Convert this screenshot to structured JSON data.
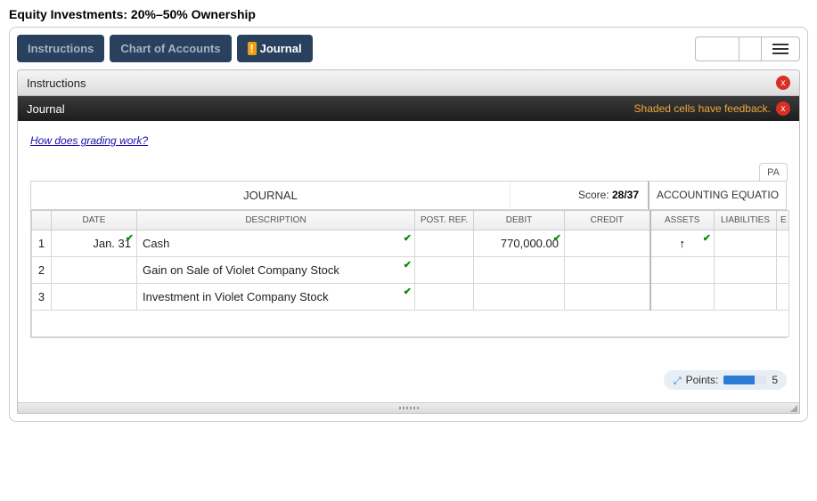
{
  "title": "Equity Investments: 20%–50% Ownership",
  "tabs": {
    "instructions": "Instructions",
    "chart_of_accounts": "Chart of Accounts",
    "journal": "Journal",
    "bang": "!"
  },
  "instructions_header": "Instructions",
  "journal_header": "Journal",
  "feedback_note": "Shaded cells have feedback.",
  "grading_link": "How does grading work?",
  "pa_tab": "PA",
  "journal_title": "JOURNAL",
  "score_label": "Score:",
  "score_value": "28/37",
  "acct_eq_label": "ACCOUNTING EQUATIO",
  "columns": {
    "date": "DATE",
    "description": "DESCRIPTION",
    "post_ref": "POST. REF.",
    "debit": "DEBIT",
    "credit": "CREDIT",
    "assets": "ASSETS",
    "liabilities": "LIABILITIES",
    "eq": "E"
  },
  "rows": [
    {
      "n": "1",
      "date": "Jan. 31",
      "description": "Cash",
      "post_ref": "",
      "debit": "770,000.00",
      "credit": "",
      "assets": "↑",
      "liabilities": "",
      "date_check": true,
      "desc_check": true,
      "debit_check": true,
      "assets_check": true
    },
    {
      "n": "2",
      "date": "",
      "description": "Gain on Sale of Violet Company Stock",
      "post_ref": "",
      "debit": "",
      "credit": "",
      "assets": "",
      "liabilities": "",
      "desc_check": true
    },
    {
      "n": "3",
      "date": "",
      "description": "Investment in Violet Company Stock",
      "post_ref": "",
      "debit": "",
      "credit": "",
      "assets": "",
      "liabilities": "",
      "desc_check": true
    }
  ],
  "points_label": "Points:",
  "points_trail": "5"
}
